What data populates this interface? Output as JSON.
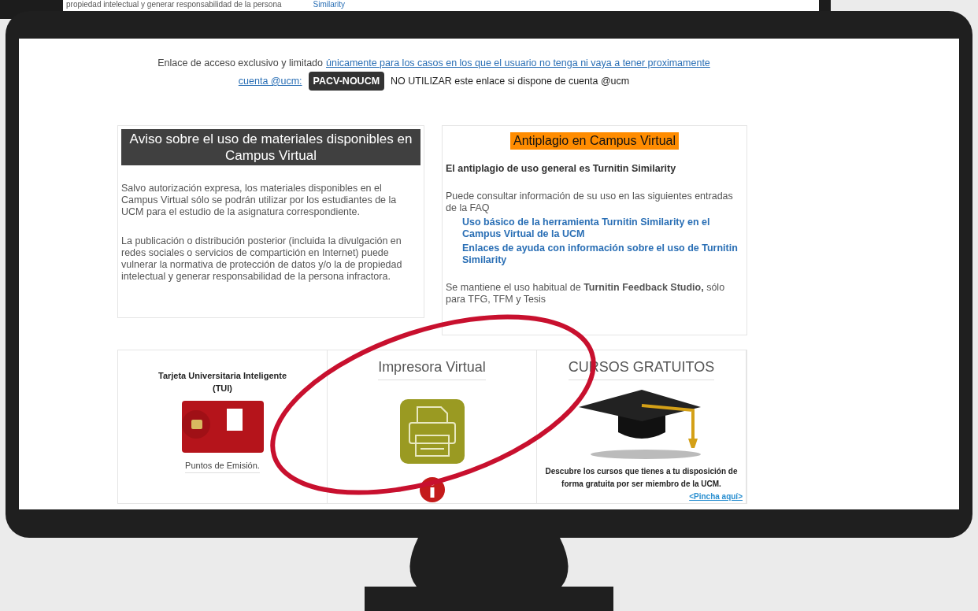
{
  "background_page": {
    "text_1": "propiedad intelectual y generar responsabilidad de la persona",
    "text_2": "Similarity"
  },
  "access_notice": {
    "text": "Enlace de acceso exclusivo y limitado",
    "link_lines": [
      "únicamente para los casos en los que el usuario no tenga ni vaya a tener proximamente",
      "cuenta @ucm:"
    ],
    "button": "PACV-NOUCM",
    "warning": "NO UTILIZAR este enlace si dispone de cuenta @ucm"
  },
  "materials_notice": {
    "title": "Aviso sobre el uso de materiales disponibles en Campus Virtual",
    "paragraphs": [
      "Salvo autorización expresa, los materiales disponibles en el Campus Virtual sólo se podrán utilizar por los estudiantes de la UCM para el estudio de la asignatura correspondiente.",
      "La publicación o distribución posterior (incluida la divulgación en redes sociales o servicios de compartición en Internet) puede vulnerar la normativa de protección de datos y/o la de propiedad intelectual y generar responsabilidad de la persona infractora."
    ]
  },
  "antiplagio": {
    "title": "Antiplagio en Campus Virtual",
    "lead": "El antiplagio de uso general es Turnitin Similarity",
    "intro": "Puede consultar información de su uso en las siguientes entradas de la FAQ",
    "links": [
      "Uso básico de la herramienta Turnitin Similarity en el Campus Virtual de la UCM",
      "Enlaces de ayuda con información sobre el uso de Turnitin Similarity"
    ],
    "note": "Se mantiene el uso habitual de **Turnitin Feedback Studio,** sólo para TFG, TFM y Tesis"
  },
  "tiles": [
    {
      "kind": "card",
      "title": "Tarjeta Universitaria Inteligente (TUI)",
      "link": "Puntos de Emisión."
    },
    {
      "kind": "printer",
      "title": "Impresora Virtual"
    },
    {
      "kind": "courses",
      "title": "CURSOS GRATUITOS",
      "text": "Descubre los cursos que tienes a tu disposición de forma gratuita por ser miembro de la UCM.",
      "link": "<Pincha aquí>"
    }
  ]
}
